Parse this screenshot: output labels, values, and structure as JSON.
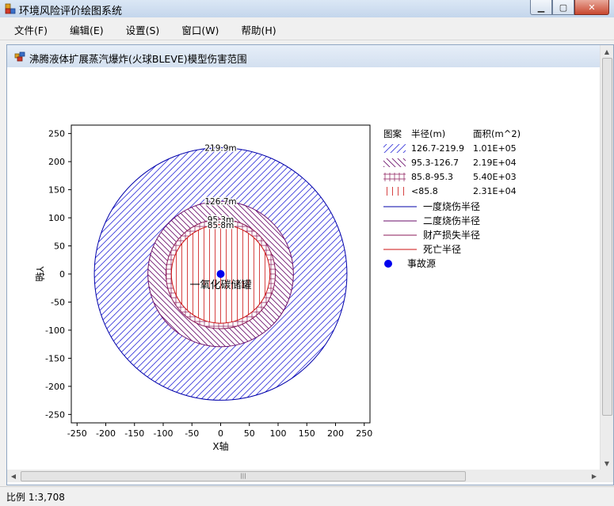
{
  "window": {
    "title": "环境风险评价绘图系统"
  },
  "menu": [
    {
      "label": "文件(F)"
    },
    {
      "label": "编辑(E)"
    },
    {
      "label": "设置(S)"
    },
    {
      "label": "窗口(W)"
    },
    {
      "label": "帮助(H)"
    }
  ],
  "child": {
    "title": "沸腾液体扩展蒸汽爆炸(火球BLEVE)模型伤害范围"
  },
  "status": {
    "scale": "比例 1:3,708"
  },
  "chart_data": {
    "type": "scatter",
    "xlabel": "X轴",
    "ylabel": "Y轴",
    "xlim": [
      -260,
      260
    ],
    "ylim": [
      -265,
      265
    ],
    "xticks": [
      -250,
      -200,
      -150,
      -100,
      -50,
      0,
      50,
      100,
      150,
      200,
      250
    ],
    "yticks": [
      250,
      200,
      150,
      100,
      50,
      0,
      -50,
      -100,
      -150,
      -200,
      -250
    ],
    "circles": [
      {
        "radius": 219.9,
        "label": "219.9m",
        "color": "#0000aa",
        "series": "一度烧伤半径"
      },
      {
        "radius": 126.7,
        "label": "126.7m",
        "color": "#6a0d6a",
        "series": "二度烧伤半径"
      },
      {
        "radius": 95.3,
        "label": "95.3m",
        "color": "#8b1a5a",
        "series": "财产损失半径"
      },
      {
        "radius": 85.8,
        "label": "85.8m",
        "color": "#cc1111",
        "series": "死亡半径"
      }
    ],
    "source": {
      "x": 0,
      "y": 0,
      "label": "一氧化碳储罐"
    },
    "legend": {
      "placement": "right",
      "headers": {
        "pattern": "图案",
        "radius": "半径(m)",
        "area": "面积(m^2)"
      },
      "fills": [
        {
          "range": "126.7-219.9",
          "area": "1.01E+05",
          "color": "#3a3adb",
          "pattern": "diag-right"
        },
        {
          "range": "95.3-126.7",
          "area": "2.19E+04",
          "color": "#6a0d6a",
          "pattern": "diag-left"
        },
        {
          "range": "85.8-95.3",
          "area": "5.40E+03",
          "color": "#8b1a5a",
          "pattern": "cross"
        },
        {
          "range": "<85.8",
          "area": "2.31E+04",
          "color": "#cc1111",
          "pattern": "vertical"
        }
      ],
      "lines": [
        {
          "label": "一度烧伤半径",
          "color": "#0000aa"
        },
        {
          "label": "二度烧伤半径",
          "color": "#6a0d6a"
        },
        {
          "label": "财产损失半径",
          "color": "#8b1a5a"
        },
        {
          "label": "死亡半径",
          "color": "#cc1111"
        }
      ],
      "point": {
        "label": "事故源",
        "color": "#0000ee"
      }
    }
  }
}
